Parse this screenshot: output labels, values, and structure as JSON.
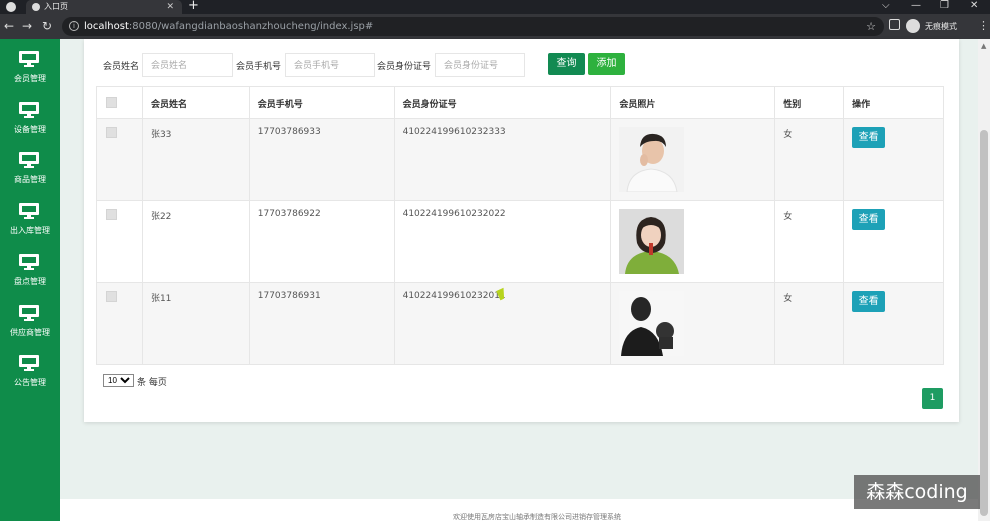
{
  "browser": {
    "tab_title": "入口页",
    "close_glyph": "✕",
    "new_tab_glyph": "+",
    "url_host": "localhost",
    "url_path": ":8080/wafangdianbaoshanzhoucheng/index.jsp#",
    "incognito_label": "无痕模式",
    "window_controls": [
      "⌵",
      "—",
      "❐",
      "✕"
    ]
  },
  "sidebar": {
    "items": [
      {
        "label": "会员管理",
        "icon": "monitor-icon"
      },
      {
        "label": "设备管理",
        "icon": "monitor-icon"
      },
      {
        "label": "商品管理",
        "icon": "monitor-icon"
      },
      {
        "label": "出入库管理",
        "icon": "monitor-icon"
      },
      {
        "label": "盘点管理",
        "icon": "monitor-icon"
      },
      {
        "label": "供应商管理",
        "icon": "monitor-icon"
      },
      {
        "label": "公告管理",
        "icon": "monitor-icon"
      }
    ]
  },
  "search": {
    "name_label": "会员姓名",
    "name_placeholder": "会员姓名",
    "phone_label": "会员手机号",
    "phone_placeholder": "会员手机号",
    "id_label": "会员身份证号",
    "id_placeholder": "会员身份证号",
    "query_button": "查询",
    "add_button": "添加"
  },
  "table": {
    "headers": [
      "会员姓名",
      "会员手机号",
      "会员身份证号",
      "会员照片",
      "性别",
      "操作"
    ],
    "rows": [
      {
        "name": "张33",
        "phone": "17703786933",
        "id_card": "410224199610232333",
        "gender": "女",
        "action": "查看",
        "photo": "young man in white shirt"
      },
      {
        "name": "张22",
        "phone": "17703786922",
        "id_card": "410224199610232022",
        "gender": "女",
        "action": "查看",
        "photo": "girl in green sweater"
      },
      {
        "name": "张11",
        "phone": "17703786931",
        "id_card": "410224199610232011",
        "gender": "女",
        "action": "查看",
        "photo": "dark silhouette"
      }
    ]
  },
  "pagination": {
    "page_size": "10",
    "per_page_text": "条 每页",
    "current_page": "1"
  },
  "footer": {
    "text": "欢迎使用瓦房店宝山轴承制造有限公司进销存管理系统"
  },
  "watermark": "森森coding",
  "colors": {
    "sidebar": "#0f8c4a",
    "query_button": "#128a52",
    "add_button": "#2eb13e",
    "view_button": "#1da1b7",
    "page_active": "#1e9c62"
  }
}
